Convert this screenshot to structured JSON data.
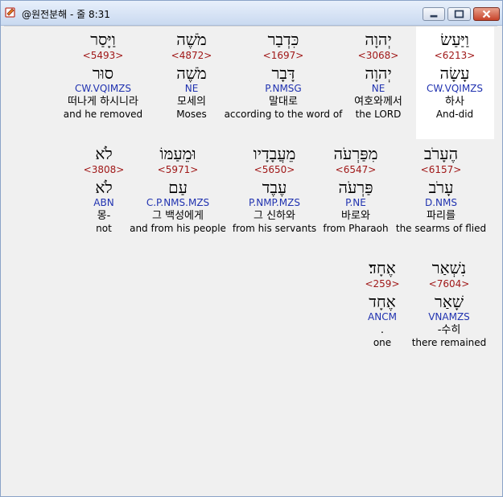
{
  "window": {
    "title": "@원전분해 - 줄 8:31"
  },
  "colors": {
    "strong": "#a01818",
    "morph": "#2032b0",
    "highlight": "#ffffff"
  },
  "words": [
    {
      "heb": "וַיָּסַר",
      "num": "<5493>",
      "lemma": "סוּר",
      "morph": "CW.VQIMZS",
      "kor": "떠나게 하시니라",
      "eng": "and he removed"
    },
    {
      "heb": "מֹשֶׁה",
      "num": "<4872>",
      "lemma": "מֹשֶׁה",
      "morph": "NE",
      "kor": "모세의",
      "eng": "Moses"
    },
    {
      "heb": "כִּדְבַר",
      "num": "<1697>",
      "lemma": "דָּבָר",
      "morph": "P.NMSG",
      "kor": "말대로",
      "eng": "according to the word of"
    },
    {
      "heb": "יְהוָה",
      "num": "<3068>",
      "lemma": "יְהוָה",
      "morph": "NE",
      "kor": "여호와께서",
      "eng": "the LORD"
    },
    {
      "heb": "וַיַּעַשׂ",
      "num": "<6213>",
      "lemma": "עָשָׂה",
      "morph": "CW.VQIMZS",
      "kor": "하사",
      "eng": "And-did"
    },
    {
      "heb": "לֹא",
      "num": "<3808>",
      "lemma": "לֹא",
      "morph": "ABN",
      "kor": "몽-",
      "eng": "not"
    },
    {
      "heb": "וּמֵעַמּוֹ",
      "num": "<5971>",
      "lemma": "עַם",
      "morph": "C.P.NMS.MZS",
      "kor": "그 백성에게",
      "eng": "and from his people"
    },
    {
      "heb": "מֵעֲבָדָיו",
      "num": "<5650>",
      "lemma": "עֶבֶד",
      "morph": "P.NMP.MZS",
      "kor": "그 신하와",
      "eng": "from his servants"
    },
    {
      "heb": "מִפַּרְעֹה",
      "num": "<6547>",
      "lemma": "פַּרְעֹה",
      "morph": "P.NE",
      "kor": "바로와",
      "eng": "from Pharaoh"
    },
    {
      "heb": "הֶעָרֹב",
      "num": "<6157>",
      "lemma": "עָרֹב",
      "morph": "D.NMS",
      "kor": "파리를",
      "eng": "the searms of flied"
    },
    {
      "heb": "אֶחָד׃",
      "num": "<259>",
      "lemma": "אֶחָד",
      "morph": "ANCM",
      "kor": ".",
      "eng": "one"
    },
    {
      "heb": "נִשְׁאַר",
      "num": "<7604>",
      "lemma": "שָׁאַר",
      "morph": "VNAMZS",
      "kor": "-수히",
      "eng": "there remained"
    }
  ]
}
